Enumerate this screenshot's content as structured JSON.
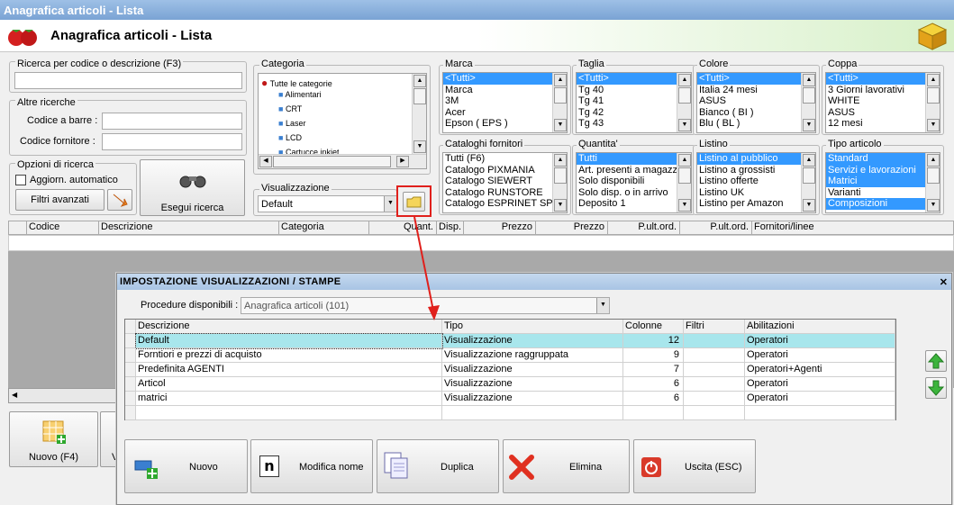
{
  "window": {
    "title": "Anagrafica articoli  - Lista"
  },
  "header": {
    "title": "Anagrafica articoli  - Lista"
  },
  "search": {
    "code_desc_label": "Ricerca per codice o descrizione (F3)",
    "code_desc_value": "",
    "other_label": "Altre ricerche",
    "barcode_label": "Codice a barre :",
    "supplier_code_label": "Codice fornitore :",
    "options_label": "Opzioni di ricerca",
    "auto_update_label": "Aggiorn. automatico",
    "advanced_filters_label": "Filtri avanzati",
    "run_search_label": "Esegui ricerca"
  },
  "categoria": {
    "label": "Categoria",
    "root": "Tutte le categorie",
    "items": [
      "Alimentari",
      "CRT",
      "Laser",
      "LCD",
      "Cartucce inkjet"
    ]
  },
  "visualizzazione": {
    "label": "Visualizzazione",
    "value": "Default"
  },
  "filters": {
    "marca": {
      "label": "Marca",
      "items": [
        "<Tutti>",
        "Marca",
        "3M",
        "Acer",
        "Epson ( EPS )"
      ],
      "selected": [
        0
      ]
    },
    "taglia": {
      "label": "Taglia",
      "items": [
        "<Tutti>",
        "Tg 40",
        "Tg 41",
        "Tg 42",
        "Tg 43"
      ],
      "selected": [
        0
      ]
    },
    "colore": {
      "label": "Colore",
      "items": [
        "<Tutti>",
        "Italia 24 mesi",
        "ASUS",
        "Bianco ( BI )",
        "Blu ( BL )"
      ],
      "selected": [
        0
      ]
    },
    "coppa": {
      "label": "Coppa",
      "items": [
        "<Tutti>",
        "3 Giorni lavorativi",
        "WHITE",
        "ASUS",
        "12 mesi"
      ],
      "selected": [
        0
      ]
    },
    "cataloghi": {
      "label": "Cataloghi fornitori",
      "items": [
        "Tutti (F6)",
        "Catalogo PIXMANIA",
        "Catalogo SIEWERT",
        "Catalogo RUNSTORE",
        "Catalogo ESPRINET SPA"
      ],
      "selected": []
    },
    "quantita": {
      "label": "Quantita'",
      "items": [
        "Tutti",
        "Art. presenti a magazzino",
        "Solo disponibili",
        "Solo disp. o in arrivo",
        "Deposito 1"
      ],
      "selected": [
        0
      ]
    },
    "listino": {
      "label": "Listino",
      "items": [
        "Listino al pubblico",
        "Listino a grossisti",
        "Listino offerte",
        "Listino UK",
        "Listino per Amazon"
      ],
      "selected": [
        0
      ]
    },
    "tipo": {
      "label": "Tipo articolo",
      "items": [
        "Standard",
        "Servizi e lavorazioni",
        "Matrici",
        "Varianti",
        "Composizioni"
      ],
      "selected": [
        0,
        1,
        2,
        4
      ]
    }
  },
  "main_grid": {
    "columns": [
      "Codice",
      "Descrizione",
      "Categoria",
      "Quant.",
      "Disp.",
      "Prezzo",
      "Prezzo",
      "P.ult.ord.",
      "P.ult.ord.",
      "Fornitori/linee"
    ]
  },
  "bottom_buttons": {
    "nuovo": "Nuovo (F4)",
    "partial": "V"
  },
  "dialog": {
    "title": "IMPOSTAZIONE VISUALIZZAZIONI / STAMPE",
    "procedure_label": "Procedure disponibili :",
    "procedure_value": "Anagrafica articoli (101)",
    "columns": [
      "Descrizione",
      "Tipo",
      "Colonne",
      "Filtri",
      "Abilitazioni"
    ],
    "rows": [
      {
        "descrizione": "Default",
        "tipo": "Visualizzazione",
        "colonne": "12",
        "filtri": "",
        "abilitazioni": "Operatori"
      },
      {
        "descrizione": "Forntiori e prezzi di acquisto",
        "tipo": "Visualizzazione raggruppata",
        "colonne": "9",
        "filtri": "",
        "abilitazioni": "Operatori"
      },
      {
        "descrizione": "Predefinita AGENTI",
        "tipo": "Visualizzazione",
        "colonne": "7",
        "filtri": "",
        "abilitazioni": "Operatori+Agenti"
      },
      {
        "descrizione": "Articol",
        "tipo": "Visualizzazione",
        "colonne": "6",
        "filtri": "",
        "abilitazioni": "Operatori"
      },
      {
        "descrizione": "matrici",
        "tipo": "Visualizzazione",
        "colonne": "6",
        "filtri": "",
        "abilitazioni": "Operatori"
      }
    ],
    "buttons": {
      "nuovo": "Nuovo",
      "modifica": "Modifica nome",
      "duplica": "Duplica",
      "elimina": "Elimina",
      "uscita": "Uscita (ESC)"
    }
  },
  "colors": {
    "selection": "#3399ff",
    "highlight_row": "#a8e6ec",
    "annotation": "#e0201c"
  }
}
